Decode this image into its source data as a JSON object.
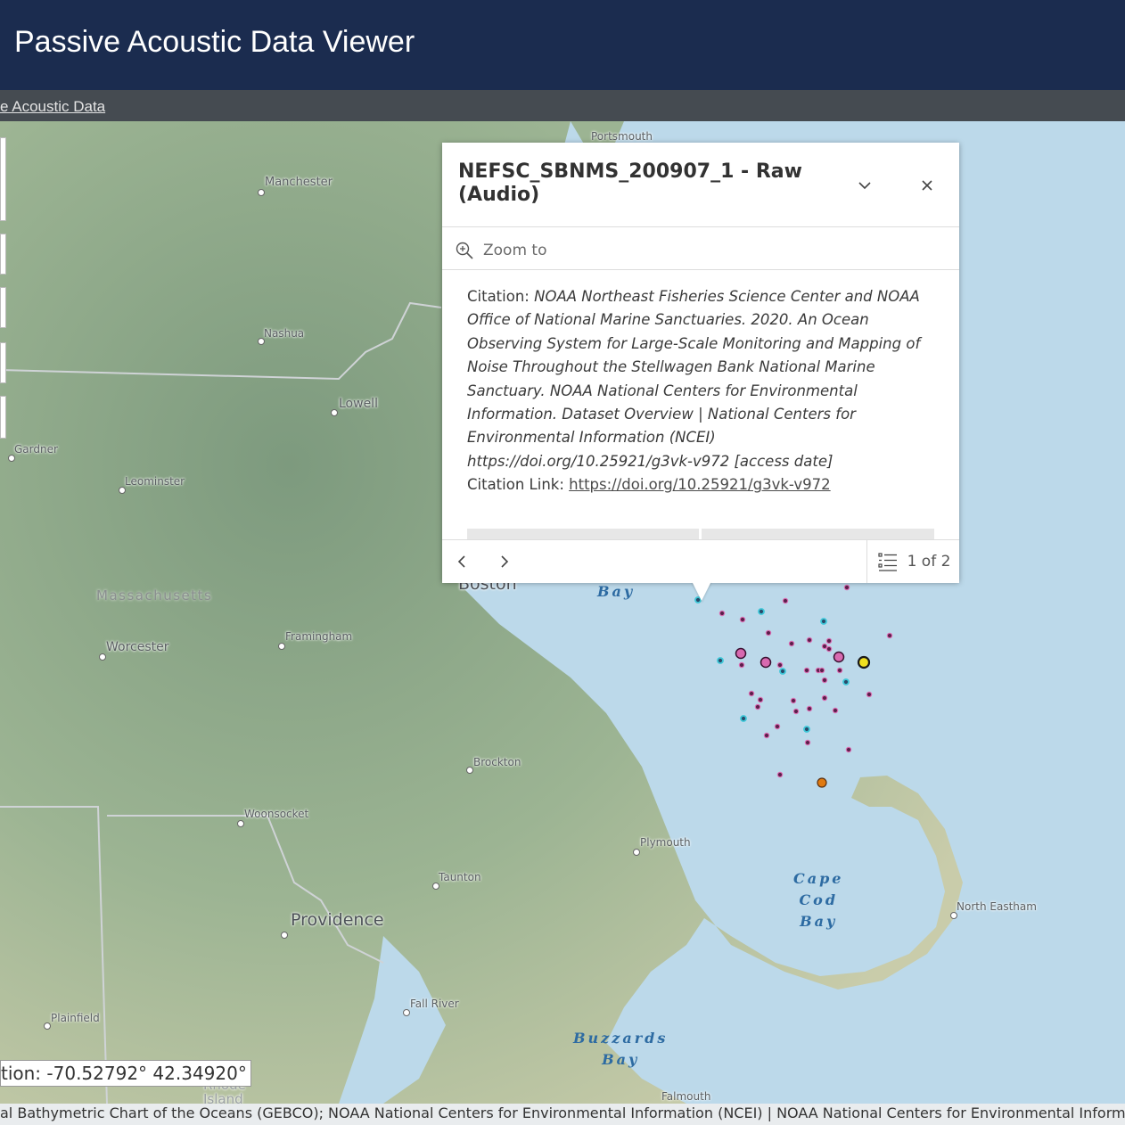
{
  "header": {
    "title": "Passive Acoustic Data Viewer"
  },
  "subbar": {
    "link_label": "e Acoustic Data"
  },
  "map": {
    "labels": {
      "portsmouth": "Portsmouth",
      "manchester": "Manchester",
      "nashua": "Nashua",
      "lowell": "Lowell",
      "gardner": "Gardner",
      "leominster": "Leominster",
      "massachusetts": "Massachusetts",
      "boston": "Boston",
      "worcester": "Worcester",
      "framingham": "Framingham",
      "brockton": "Brockton",
      "woonsocket": "Woonsocket",
      "plymouth": "Plymouth",
      "taunton": "Taunton",
      "providence": "Providence",
      "north_eastham": "North Eastham",
      "fall_river": "Fall River",
      "plainfield": "Plainfield",
      "rhode_island": "Rhode Island",
      "falmouth": "Falmouth"
    },
    "water": {
      "mass_bay": "Bay",
      "cape_cod_bay": [
        "Cape",
        "Cod",
        "Bay"
      ],
      "buzzards_bay": [
        "Buzzards",
        "Bay"
      ]
    },
    "marker_colors": {
      "recording": "#5a1f4a",
      "recording_ring": "#d86ab0",
      "highlight_cyan": "#3ec7d8",
      "selected": "#f0e020",
      "other": "#e07a10"
    }
  },
  "popup": {
    "title": "NEFSC_SBNMS_200907_1 - Raw (Audio)",
    "collapse_icon": "chevron-down-icon",
    "close_icon": "close-icon",
    "zoom_label": "Zoom to",
    "citation_label": "Citation: ",
    "citation_text": "NOAA Northeast Fisheries Science Center and NOAA Office of National Marine Sanctuaries. 2020. An Ocean Observing System for Large-Scale Monitoring and Mapping of Noise Throughout the Stellwagen Bank National Marine Sanctuary. NOAA National Centers for Environmental Information. Dataset Overview | National Centers for Environmental Information (NCEI) https://doi.org/10.25921/g3vk-v972 [access date]",
    "citation_link_label": "Citation Link: ",
    "citation_link_text": "https://doi.org/10.25921/g3vk-v972",
    "feature_count": "1 of 2"
  },
  "coordinates": {
    "text": "tion: -70.52792° 42.34920°"
  },
  "attribution": {
    "text": "al Bathymetric Chart of the Oceans (GEBCO); NOAA National Centers for Environmental Information (NCEI) | NOAA National Centers for Environmental Inform"
  }
}
